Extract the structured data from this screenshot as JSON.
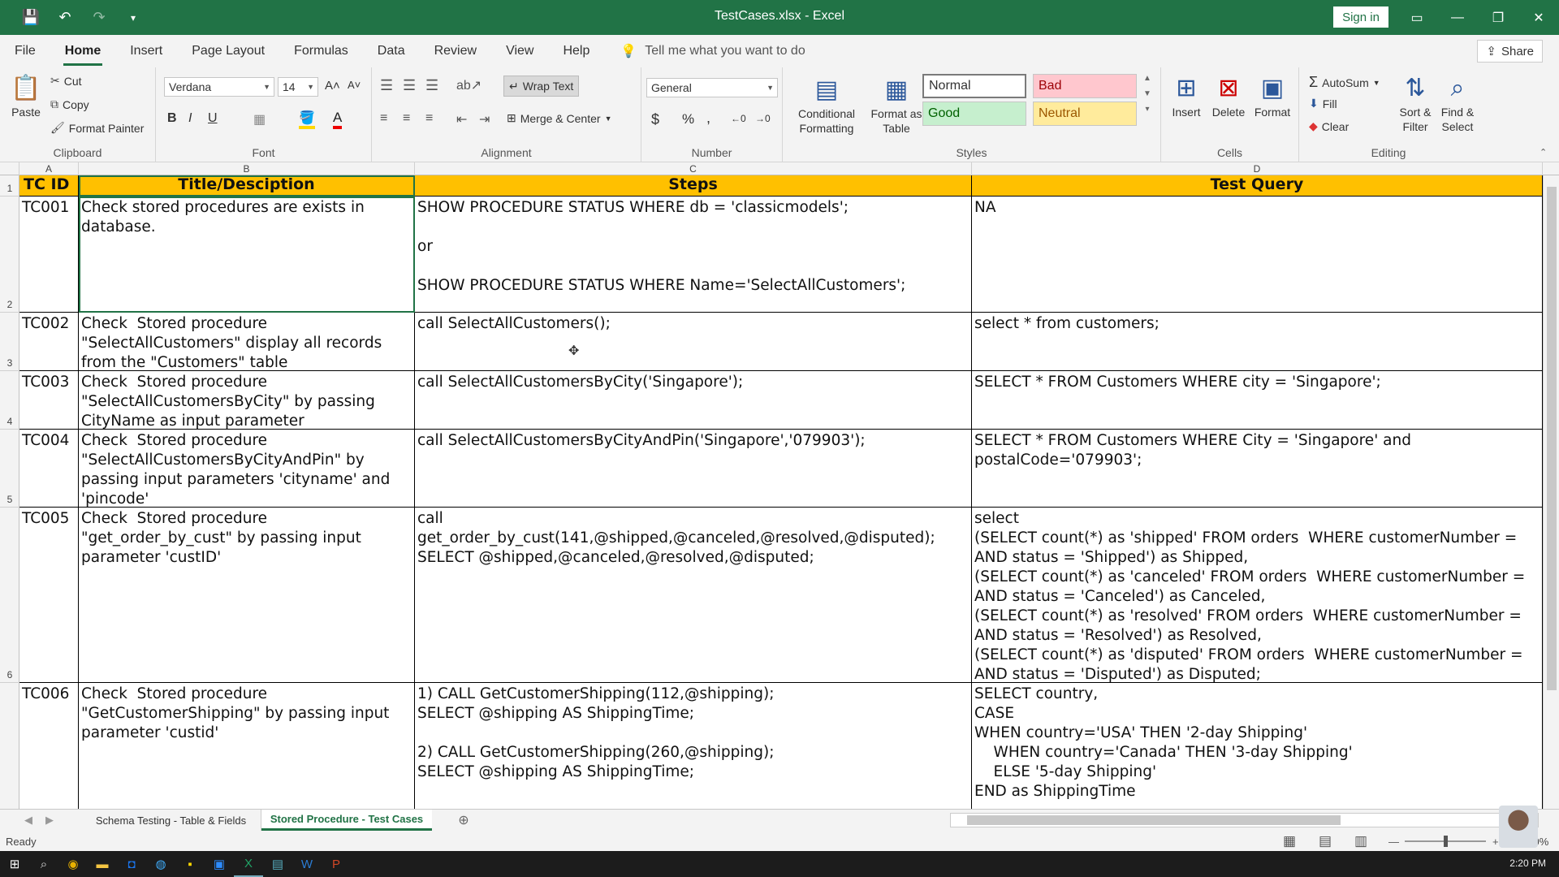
{
  "window": {
    "title": "TestCases.xlsx  -  Excel",
    "sign_in": "Sign in"
  },
  "quick_access": {
    "save_icon": "save-icon",
    "undo_icon": "undo-icon",
    "redo_icon": "redo-icon"
  },
  "menu": {
    "tabs": [
      "File",
      "Home",
      "Insert",
      "Page Layout",
      "Formulas",
      "Data",
      "Review",
      "View",
      "Help"
    ],
    "active_tab": "Home",
    "tell_me": "Tell me what you want to do",
    "share": "Share"
  },
  "ribbon": {
    "clipboard": {
      "paste": "Paste",
      "cut": "Cut",
      "copy": "Copy",
      "format_painter": "Format Painter",
      "label": "Clipboard"
    },
    "font": {
      "name": "Verdana",
      "size": "14",
      "bold": "B",
      "italic": "I",
      "underline": "U",
      "label": "Font"
    },
    "alignment": {
      "wrap_text": "Wrap Text",
      "merge_center": "Merge & Center",
      "label": "Alignment"
    },
    "number": {
      "format": "General",
      "currency": "$",
      "percent": "%",
      "comma": ",",
      "label": "Number"
    },
    "styles": {
      "conditional": "Conditional",
      "formatting": "Formatting",
      "format_as": "Format as",
      "table": "Table",
      "normal": "Normal",
      "bad": "Bad",
      "good": "Good",
      "neutral": "Neutral",
      "label": "Styles"
    },
    "cells": {
      "insert": "Insert",
      "delete": "Delete",
      "format": "Format",
      "label": "Cells"
    },
    "editing": {
      "autosum": "AutoSum",
      "fill": "Fill",
      "clear": "Clear",
      "sort": "Sort &",
      "filter": "Filter",
      "find": "Find &",
      "select": "Select",
      "label": "Editing"
    }
  },
  "columns": [
    "A",
    "B",
    "C",
    "D"
  ],
  "rows": [
    "1",
    "2",
    "3",
    "4",
    "5",
    "6"
  ],
  "sheet": {
    "headers": [
      "TC ID",
      "Title/Desciption",
      "Steps",
      "Test Query"
    ],
    "data": [
      [
        "TC001",
        "Check stored procedures are exists in database.",
        "SHOW PROCEDURE STATUS WHERE db = 'classicmodels';\n\nor\n\nSHOW PROCEDURE STATUS WHERE Name='SelectAllCustomers';",
        "NA"
      ],
      [
        "TC002",
        "Check  Stored procedure \"SelectAllCustomers\" display all records from the \"Customers\" table",
        "call SelectAllCustomers();",
        "select * from customers;"
      ],
      [
        "TC003",
        "Check  Stored procedure \"SelectAllCustomersByCity\" by passing CityName as input parameter",
        "call SelectAllCustomersByCity('Singapore');",
        "SELECT * FROM Customers WHERE city = 'Singapore';"
      ],
      [
        "TC004",
        "Check  Stored procedure \"SelectAllCustomersByCityAndPin\" by passing input parameters 'cityname' and 'pincode'",
        "call SelectAllCustomersByCityAndPin('Singapore','079903');",
        "SELECT * FROM Customers WHERE City = 'Singapore' and postalCode='079903';"
      ],
      [
        "TC005",
        "Check  Stored procedure \"get_order_by_cust\" by passing input parameter 'custID'",
        "call\nget_order_by_cust(141,@shipped,@canceled,@resolved,@disputed);\nSELECT @shipped,@canceled,@resolved,@disputed;",
        "select\n(SELECT count(*) as 'shipped' FROM orders  WHERE customerNumber =\nAND status = 'Shipped') as Shipped,\n(SELECT count(*) as 'canceled' FROM orders  WHERE customerNumber =\nAND status = 'Canceled') as Canceled,\n(SELECT count(*) as 'resolved' FROM orders  WHERE customerNumber =\nAND status = 'Resolved') as Resolved,\n(SELECT count(*) as 'disputed' FROM orders  WHERE customerNumber =\nAND status = 'Disputed') as Disputed;"
      ],
      [
        "TC006",
        "Check  Stored procedure \"GetCustomerShipping\" by passing input parameter 'custid'",
        "1) CALL GetCustomerShipping(112,@shipping);\nSELECT @shipping AS ShippingTime;\n\n2) CALL GetCustomerShipping(260,@shipping);\nSELECT @shipping AS ShippingTime;",
        "SELECT country,\nCASE\nWHEN country='USA' THEN '2-day Shipping'\n    WHEN country='Canada' THEN '3-day Shipping'\n    ELSE '5-day Shipping'\nEND as ShippingTime"
      ]
    ]
  },
  "sheet_tabs": [
    "Schema Testing - Table & Fields",
    "Stored Procedure - Test Cases"
  ],
  "active_sheet": "Stored Procedure - Test Cases",
  "status": {
    "ready": "Ready",
    "zoom": "100%"
  },
  "taskbar": {
    "clock": "2:20 PM"
  }
}
